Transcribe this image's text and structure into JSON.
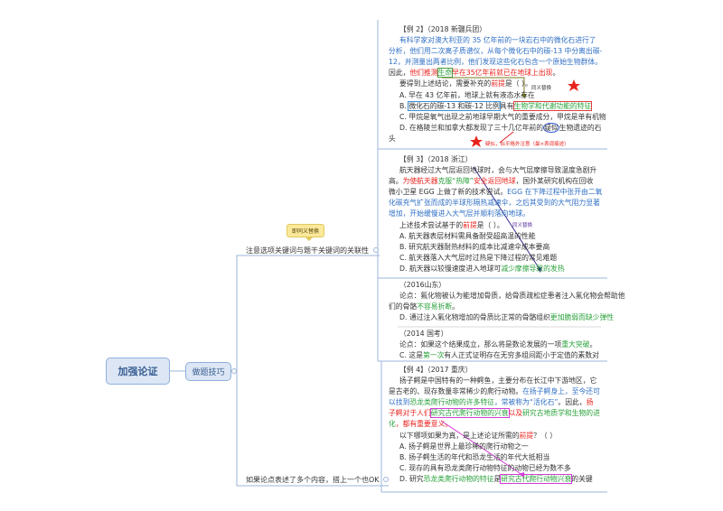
{
  "root": {
    "label": "加强论证"
  },
  "branch": {
    "label": "做题技巧"
  },
  "topics": [
    {
      "label": "注意选项关键词与题干关键词的关联性",
      "callout": "即同义替换"
    },
    {
      "label": "如果论点表述了多个内容，搭上一个也OK"
    }
  ],
  "annotations": {
    "ex2_synonym": "同义替换",
    "ex2_doubt": "疑似，似乎格外注意（最×表现痕迹）",
    "ex3_synonym": "同义替换"
  },
  "colors": {
    "blue": "#2f6fc4",
    "red": "#e8231d",
    "green": "#28a03a",
    "node": "#dce6f4"
  },
  "examples": [
    {
      "lines": [
        {
          "i": 1,
          "segs": [
            {
              "t": "【例 2】（2018 新疆兵团）",
              "c": "k"
            }
          ]
        },
        {
          "i": 1,
          "segs": [
            {
              "t": "有科学家对澳大利亚的 35 亿年前的一块岩石中的微化石进行了",
              "c": "b"
            }
          ]
        },
        {
          "i": 0,
          "segs": [
            {
              "t": "分析，他们用二次离子质谱仪，从每个微化石中的碳-13 中分离出碳-",
              "c": "b"
            }
          ]
        },
        {
          "i": 0,
          "segs": [
            {
              "t": "12，并测量出两者比例，他们发现这些化石包含一个原始生物群体。",
              "c": "b"
            }
          ]
        },
        {
          "i": 0,
          "segs": [
            {
              "t": "因此，",
              "c": "k"
            },
            {
              "t": "他们推测",
              "c": "r"
            },
            {
              "t": "生命",
              "c": "g",
              "box": "box-g"
            },
            {
              "t": "早在35亿年前就已在地球上出现",
              "c": "r"
            },
            {
              "t": "。",
              "c": "k"
            }
          ]
        },
        {
          "i": 1,
          "segs": [
            {
              "t": "要得到上述结论，需要补充的",
              "c": "k"
            },
            {
              "t": "前提",
              "c": "r"
            },
            {
              "t": "是（ ）。",
              "c": "k"
            }
          ]
        },
        {
          "i": 1,
          "segs": [
            {
              "t": "A. 早在 43 亿年前，地球上就有液态水存在",
              "c": "k"
            }
          ]
        },
        {
          "i": 1,
          "segs": [
            {
              "t": "B. ",
              "c": "k"
            },
            {
              "t": "微化石的碳-13 和碳-12 比例",
              "c": "k",
              "box": "box-b"
            },
            {
              "t": "具有",
              "c": "k"
            },
            {
              "t": "生物学和代谢功能的特征",
              "c": "g",
              "box": "box-r"
            }
          ]
        },
        {
          "i": 1,
          "segs": [
            {
              "t": "C. 甲烷是氧气出现之前地球早期大气的重要成分，甲烷是单有机物",
              "c": "k"
            }
          ]
        },
        {
          "i": 1,
          "segs": [
            {
              "t": "D. 在格陵兰和加拿大都发现了三十几亿年前的",
              "c": "k"
            },
            {
              "t": "疑似",
              "c": "k",
              "box": "circ"
            },
            {
              "t": "生物遗迹的石",
              "c": "k"
            }
          ]
        },
        {
          "i": 0,
          "segs": [
            {
              "t": "头",
              "c": "k"
            }
          ]
        }
      ]
    },
    {
      "lines": [
        {
          "i": 1,
          "segs": [
            {
              "t": "【例 3】（2018 浙江）",
              "c": "k"
            }
          ]
        },
        {
          "i": 1,
          "segs": [
            {
              "t": "航天器经过大气层返回地球时，会与大气层摩擦导致温度急剧升",
              "c": "k"
            }
          ]
        },
        {
          "i": 0,
          "segs": [
            {
              "t": "高。",
              "c": "k"
            },
            {
              "t": "为使航天器",
              "c": "r"
            },
            {
              "t": "克服“热障”",
              "c": "g"
            },
            {
              "t": "安全返回地球",
              "c": "r"
            },
            {
              "t": "，国外某研究机构在回收",
              "c": "k"
            }
          ]
        },
        {
          "i": 0,
          "segs": [
            {
              "t": "微小卫星 EGG 上做了新的技术尝试。",
              "c": "k"
            },
            {
              "t": "EGG 在下降过程中张开由二氧",
              "c": "b"
            }
          ]
        },
        {
          "i": 0,
          "segs": [
            {
              "t": "化碳充气扩张而成的半球形隔热减速伞，之后其受到的大气阻力显著",
              "c": "b"
            }
          ]
        },
        {
          "i": 0,
          "segs": [
            {
              "t": "增加，开始缓慢进入大气层并顺利落向地球。",
              "c": "b"
            }
          ]
        },
        {
          "i": 1,
          "segs": [
            {
              "t": "上述技术尝试基于的",
              "c": "k"
            },
            {
              "t": "前提",
              "c": "r"
            },
            {
              "t": "是（ ）。",
              "c": "k"
            }
          ]
        },
        {
          "i": 1,
          "segs": [
            {
              "t": "A. 航天器表层材料需具备耐受超高温的性能",
              "c": "k"
            }
          ]
        },
        {
          "i": 1,
          "segs": [
            {
              "t": "B. 研究航天器耐热材料的成本比减速伞成本要高",
              "c": "k"
            }
          ]
        },
        {
          "i": 1,
          "segs": [
            {
              "t": "C. 航天器落入大气层时过热是下降过程的常见难题",
              "c": "k"
            }
          ]
        },
        {
          "i": 1,
          "segs": [
            {
              "t": "D. 航天器以较慢速度进入地球可",
              "c": "k"
            },
            {
              "t": "减少摩擦导致的发热",
              "c": "g"
            }
          ]
        }
      ]
    },
    {
      "lines": [
        {
          "i": 1,
          "segs": [
            {
              "t": "（2016山东）",
              "c": "k"
            }
          ]
        },
        {
          "i": 1,
          "segs": [
            {
              "t": "论点：氟化物被认为能增加骨质，给骨质疏松症患者注入氟化物会帮助他",
              "c": "k"
            }
          ]
        },
        {
          "i": 0,
          "segs": [
            {
              "t": "们的骨骼",
              "c": "k"
            },
            {
              "t": "不容易折断",
              "c": "g"
            },
            {
              "t": "。",
              "c": "k"
            }
          ]
        },
        {
          "i": 1,
          "segs": [
            {
              "t": "D. 通过注入氟化物增加的骨质比正常的骨骼组织",
              "c": "k"
            },
            {
              "t": "更加脆弱而缺少弹性",
              "c": "g"
            }
          ]
        }
      ]
    },
    {
      "lines": [
        {
          "i": 1,
          "segs": [
            {
              "t": "（2014 国考）",
              "c": "k"
            }
          ]
        },
        {
          "i": 1,
          "segs": [
            {
              "t": "论点：如果这个结果成立，那么将是数论发展的一项",
              "c": "k"
            },
            {
              "t": "重大突破",
              "c": "g"
            },
            {
              "t": "。",
              "c": "k"
            }
          ]
        },
        {
          "i": 1,
          "segs": [
            {
              "t": "C. 这是",
              "c": "k"
            },
            {
              "t": "第一次",
              "c": "g"
            },
            {
              "t": "有人正式证明存在无穷多组间距小于定值的素数对",
              "c": "k"
            }
          ]
        }
      ]
    },
    {
      "lines": [
        {
          "i": 1,
          "segs": [
            {
              "t": "【例 4】（2017 重庆）",
              "c": "k"
            }
          ]
        },
        {
          "i": 1,
          "segs": [
            {
              "t": "扬子鳄是中国特有的一种鳄鱼，主要分布在长江中下游地区，它",
              "c": "k"
            }
          ]
        },
        {
          "i": 0,
          "segs": [
            {
              "t": "是古老的、现存数量非常稀少的爬行动物。",
              "c": "k"
            },
            {
              "t": "在扬子鳄身上，至今还可",
              "c": "b"
            }
          ]
        },
        {
          "i": 0,
          "segs": [
            {
              "t": "以找到",
              "c": "b"
            },
            {
              "t": "恐龙类爬行动物的许多特征",
              "c": "g"
            },
            {
              "t": "，常被称为“活化石”",
              "c": "b"
            },
            {
              "t": "。因此，",
              "c": "k"
            },
            {
              "t": "扬",
              "c": "r"
            }
          ]
        },
        {
          "i": 0,
          "segs": [
            {
              "t": "子鳄对于人们",
              "c": "r"
            },
            {
              "t": "研究古代爬行动物的兴衰",
              "c": "g",
              "box": "box-m"
            },
            {
              "t": "以及",
              "c": "r"
            },
            {
              "t": "研究古地质学和生物的进",
              "c": "g"
            }
          ]
        },
        {
          "i": 0,
          "segs": [
            {
              "t": "化",
              "c": "g"
            },
            {
              "t": "，都有重要意义。",
              "c": "r"
            }
          ]
        },
        {
          "i": 1,
          "segs": [
            {
              "t": "以下哪项如果为真，是上述论证所需的",
              "c": "k"
            },
            {
              "t": "前提",
              "c": "r"
            },
            {
              "t": "？（ ）",
              "c": "k"
            }
          ]
        },
        {
          "i": 1,
          "segs": [
            {
              "t": "A. 扬子鳄是世界上最珍稀的爬行动物之一",
              "c": "k"
            }
          ]
        },
        {
          "i": 1,
          "segs": [
            {
              "t": "B. 扬子鳄生活的年代和恐龙生活的年代大抵相当",
              "c": "k"
            }
          ]
        },
        {
          "i": 1,
          "segs": [
            {
              "t": "C. 现存的具有恐龙类爬行动物特征的动物已经为数不多",
              "c": "k"
            }
          ]
        },
        {
          "i": 1,
          "segs": [
            {
              "t": "D. 研究",
              "c": "k"
            },
            {
              "t": "恐龙类爬行动物的特征",
              "c": "g"
            },
            {
              "t": "是",
              "c": "k"
            },
            {
              "t": "研究古代爬行动物兴衰",
              "c": "g",
              "box": "box-m"
            },
            {
              "t": "的关键",
              "c": "k"
            }
          ]
        }
      ]
    }
  ]
}
